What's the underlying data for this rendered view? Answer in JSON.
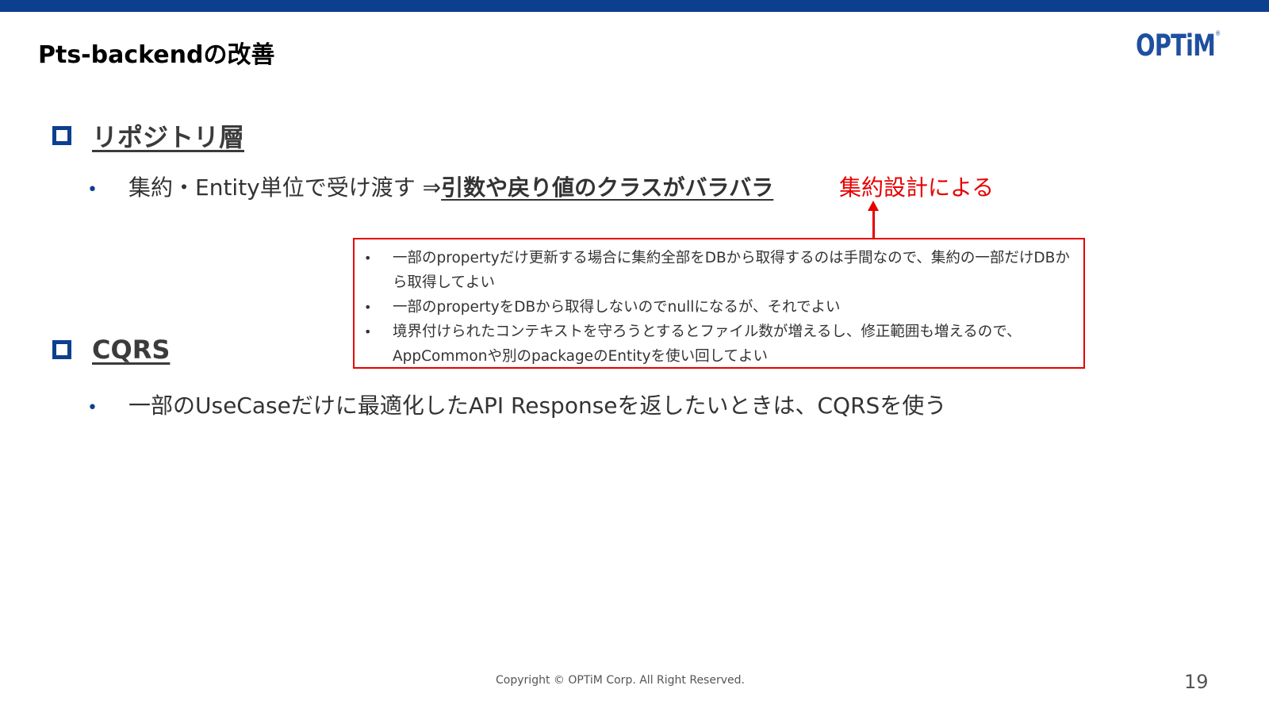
{
  "header": {
    "title": "Pts-backendの改善",
    "logo_text": "OPTiM",
    "logo_mark": "®"
  },
  "sections": [
    {
      "heading": "リポジトリ層",
      "point": {
        "bullet": "•",
        "text_before": "集約・Entity単位で受け渡す ⇒ ",
        "emphasis": "引数や戻り値のクラスがバラバラ"
      },
      "annotation": "集約設計による"
    },
    {
      "heading": "CQRS",
      "point": {
        "bullet": "•",
        "text": "一部のUseCaseだけに最適化したAPI Responseを返したいときは、CQRSを使う"
      }
    }
  ],
  "note_box": {
    "items": [
      "一部のpropertyだけ更新する場合に集約全部をDBから取得するのは手間なので、集約の一部だけDBから取得してよい",
      "一部のpropertyをDBから取得しないのでnullになるが、それでよい",
      "境界付けられたコンテキストを守ろうとするとファイル数が増えるし、修正範囲も増えるので、AppCommonや別のpackageのEntityを使い回してよい"
    ]
  },
  "footer": {
    "copyright": "Copyright © OPTiM Corp. All Right Reserved.",
    "page_number": "19"
  },
  "colors": {
    "brand_blue": "#0d3f8f",
    "accent_red": "#e60000"
  }
}
